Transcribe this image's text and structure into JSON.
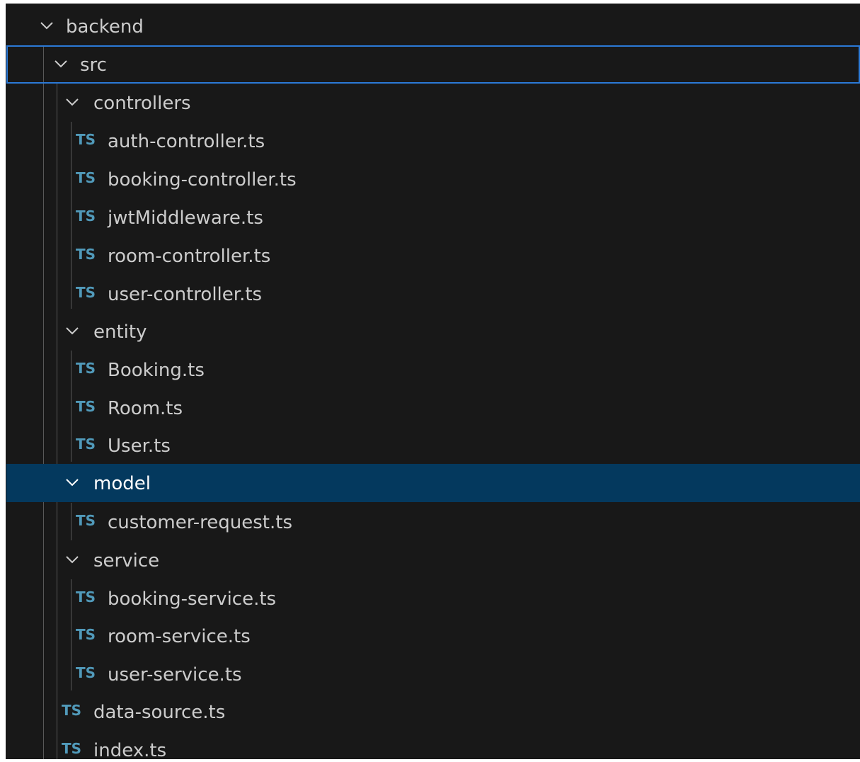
{
  "explorer": {
    "colors": {
      "background": "#181818",
      "selected_row": "#04395e",
      "focus_border": "#2b79d6",
      "ts_icon": "#519aba",
      "label": "#cccccc"
    },
    "tree": {
      "backend": {
        "label": "backend",
        "icon": "chevron-down-icon"
      },
      "src": {
        "label": "src",
        "icon": "chevron-down-icon"
      },
      "controllers": {
        "label": "controllers",
        "files": [
          {
            "icon": "TS",
            "label": "auth-controller.ts"
          },
          {
            "icon": "TS",
            "label": "booking-controller.ts"
          },
          {
            "icon": "TS",
            "label": "jwtMiddleware.ts"
          },
          {
            "icon": "TS",
            "label": "room-controller.ts"
          },
          {
            "icon": "TS",
            "label": "user-controller.ts"
          }
        ]
      },
      "entity": {
        "label": "entity",
        "files": [
          {
            "icon": "TS",
            "label": "Booking.ts"
          },
          {
            "icon": "TS",
            "label": "Room.ts"
          },
          {
            "icon": "TS",
            "label": "User.ts"
          }
        ]
      },
      "model": {
        "label": "model",
        "files": [
          {
            "icon": "TS",
            "label": "customer-request.ts"
          }
        ]
      },
      "service": {
        "label": "service",
        "files": [
          {
            "icon": "TS",
            "label": "booking-service.ts"
          },
          {
            "icon": "TS",
            "label": "room-service.ts"
          },
          {
            "icon": "TS",
            "label": "user-service.ts"
          }
        ]
      },
      "root_files": [
        {
          "icon": "TS",
          "label": "data-source.ts"
        },
        {
          "icon": "TS",
          "label": "index.ts"
        }
      ]
    }
  }
}
